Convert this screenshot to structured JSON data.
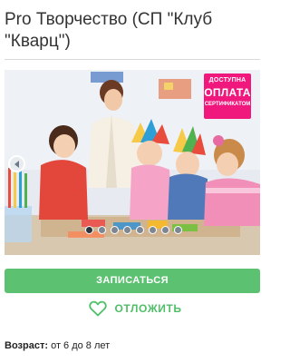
{
  "page": {
    "title": "Pro Творчество (СП \"Клуб \"Кварц\")"
  },
  "carousel": {
    "image_alt": "Дети занимаются творчеством за столом с педагогом",
    "promo_badge": {
      "line1": "ДОСТУПНА",
      "line2": "ОПЛАТА",
      "line3": "СЕРТИФИКАТОМ",
      "color": "#f0177d"
    },
    "prev_icon": "chevron-left-icon",
    "slide_count": 8,
    "active_slide": 1
  },
  "actions": {
    "enroll_label": "ЗАПИСАТЬСЯ",
    "postpone_label": "ОТЛОЖИТЬ",
    "postpone_icon": "heart-outline-icon",
    "accent_color": "#5cc272"
  },
  "info": {
    "age_label": "Возраст:",
    "age_value": "от 6 до 8 лет"
  }
}
